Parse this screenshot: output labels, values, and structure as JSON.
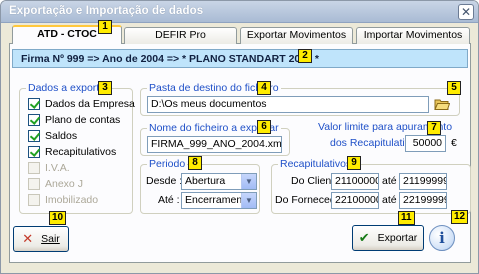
{
  "window": {
    "title": "Exportação e Importação de dados",
    "close_glyph": "✕"
  },
  "tabs": [
    {
      "label": "ATD - CTOC",
      "active": true
    },
    {
      "label": "DEFIR Pro",
      "active": false
    },
    {
      "label": "Exportar Movimentos",
      "active": false
    },
    {
      "label": "Importar Movimentos",
      "active": false
    }
  ],
  "banner": {
    "text": "Firma Nº 999 => Ano de 2004 => * PLANO STANDART 2004 *"
  },
  "export_data": {
    "label": "Dados a exportar",
    "items": [
      {
        "label": "Dados da Empresa",
        "checked": true,
        "enabled": true
      },
      {
        "label": "Plano de contas",
        "checked": true,
        "enabled": true
      },
      {
        "label": "Saldos",
        "checked": true,
        "enabled": true
      },
      {
        "label": "Recapitulativos",
        "checked": true,
        "enabled": true
      },
      {
        "label": "I.V.A.",
        "checked": false,
        "enabled": false
      },
      {
        "label": "Anexo J",
        "checked": false,
        "enabled": false
      },
      {
        "label": "Imobilizado",
        "checked": false,
        "enabled": false
      }
    ]
  },
  "destination": {
    "label": "Pasta de destino do ficheiro",
    "value": "D:\\Os meus documentos",
    "browse_icon": "folder-open-icon"
  },
  "filename": {
    "label": "Nome do ficheiro a exportar",
    "value": "FIRMA_999_ANO_2004.xml"
  },
  "limit": {
    "label_line1": "Valor limite para apuramento",
    "label_line2": "dos Recapitulativos",
    "value": "50000",
    "currency": "€"
  },
  "period": {
    "label": "Periodo",
    "from_label": "Desde :",
    "from_value": "Abertura",
    "to_label": "Até :",
    "to_value": "Encerramento"
  },
  "recap": {
    "label": "Recapitulativos",
    "client_label": "Do Cliente",
    "client_from": "211000000",
    "client_to": "211999999",
    "supplier_label": "Do Forneced.",
    "supplier_from": "221000000",
    "supplier_to": "221999999",
    "ate": "até"
  },
  "buttons": {
    "exit": "Sair",
    "export": "Exportar",
    "info": "i"
  },
  "badges": [
    "1",
    "2",
    "3",
    "4",
    "5",
    "6",
    "7",
    "8",
    "9",
    "10",
    "11",
    "12"
  ],
  "colors": {
    "accent_label": "#1f50c8",
    "banner_bg": "#bfe4fb",
    "badge": "#ffec00",
    "check": "#21a121"
  }
}
